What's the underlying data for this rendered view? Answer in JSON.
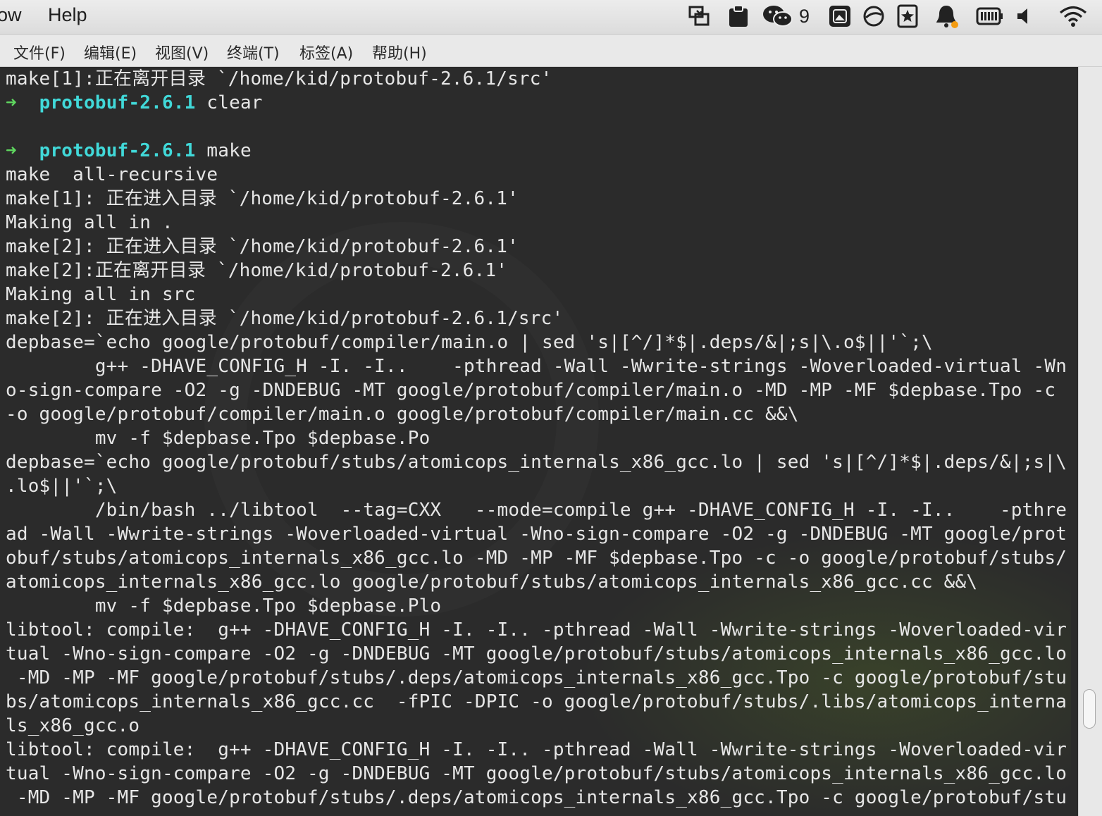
{
  "system_menu": {
    "view": "ow",
    "help": "Help"
  },
  "tray": {
    "icons": [
      "screen-share-icon",
      "clipboard-icon",
      "wechat-icon",
      "photos-icon",
      "circle-slash-icon",
      "bookmark-star-icon",
      "notification-bell-icon",
      "battery-icon",
      "volume-icon",
      "wifi-icon"
    ],
    "wechat_count": "9"
  },
  "terminal_menu": {
    "file": "文件(F)",
    "edit": "编辑(E)",
    "view": "视图(V)",
    "terminal": "终端(T)",
    "tabs": "标签(A)",
    "help": "帮助(H)"
  },
  "terminal": {
    "colors": {
      "background": "#2b2b2b",
      "text": "#e6e6e6",
      "prompt_arrow": "#5fd75f",
      "prompt_dir": "#41d9d9"
    },
    "lines": [
      {
        "text": "make[1]:正在离开目录 `/home/kid/protobuf-2.6.1/src'"
      },
      {
        "arrow": "➜",
        "dir": "protobuf-2.6.1",
        "text": " clear"
      },
      {
        "text": ""
      },
      {
        "arrow": "➜",
        "dir": "protobuf-2.6.1",
        "text": " make"
      },
      {
        "text": "make  all-recursive"
      },
      {
        "text": "make[1]: 正在进入目录 `/home/kid/protobuf-2.6.1'"
      },
      {
        "text": "Making all in ."
      },
      {
        "text": "make[2]: 正在进入目录 `/home/kid/protobuf-2.6.1'"
      },
      {
        "text": "make[2]:正在离开目录 `/home/kid/protobuf-2.6.1'"
      },
      {
        "text": "Making all in src"
      },
      {
        "text": "make[2]: 正在进入目录 `/home/kid/protobuf-2.6.1/src'"
      },
      {
        "text": "depbase=`echo google/protobuf/compiler/main.o | sed 's|[^/]*$|.deps/&|;s|\\.o$||'`;\\"
      },
      {
        "text": "        g++ -DHAVE_CONFIG_H -I. -I..    -pthread -Wall -Wwrite-strings -Woverloaded-virtual -Wn"
      },
      {
        "text": "o-sign-compare -O2 -g -DNDEBUG -MT google/protobuf/compiler/main.o -MD -MP -MF $depbase.Tpo -c"
      },
      {
        "text": "-o google/protobuf/compiler/main.o google/protobuf/compiler/main.cc &&\\"
      },
      {
        "text": "        mv -f $depbase.Tpo $depbase.Po"
      },
      {
        "text": "depbase=`echo google/protobuf/stubs/atomicops_internals_x86_gcc.lo | sed 's|[^/]*$|.deps/&|;s|\\"
      },
      {
        "text": ".lo$||'`;\\"
      },
      {
        "text": "        /bin/bash ../libtool  --tag=CXX   --mode=compile g++ -DHAVE_CONFIG_H -I. -I..    -pthre"
      },
      {
        "text": "ad -Wall -Wwrite-strings -Woverloaded-virtual -Wno-sign-compare -O2 -g -DNDEBUG -MT google/prot"
      },
      {
        "text": "obuf/stubs/atomicops_internals_x86_gcc.lo -MD -MP -MF $depbase.Tpo -c -o google/protobuf/stubs/"
      },
      {
        "text": "atomicops_internals_x86_gcc.lo google/protobuf/stubs/atomicops_internals_x86_gcc.cc &&\\"
      },
      {
        "text": "        mv -f $depbase.Tpo $depbase.Plo"
      },
      {
        "text": "libtool: compile:  g++ -DHAVE_CONFIG_H -I. -I.. -pthread -Wall -Wwrite-strings -Woverloaded-vir"
      },
      {
        "text": "tual -Wno-sign-compare -O2 -g -DNDEBUG -MT google/protobuf/stubs/atomicops_internals_x86_gcc.lo"
      },
      {
        "text": " -MD -MP -MF google/protobuf/stubs/.deps/atomicops_internals_x86_gcc.Tpo -c google/protobuf/stu"
      },
      {
        "text": "bs/atomicops_internals_x86_gcc.cc  -fPIC -DPIC -o google/protobuf/stubs/.libs/atomicops_interna"
      },
      {
        "text": "ls_x86_gcc.o"
      },
      {
        "text": "libtool: compile:  g++ -DHAVE_CONFIG_H -I. -I.. -pthread -Wall -Wwrite-strings -Woverloaded-vir"
      },
      {
        "text": "tual -Wno-sign-compare -O2 -g -DNDEBUG -MT google/protobuf/stubs/atomicops_internals_x86_gcc.lo"
      },
      {
        "text": " -MD -MP -MF google/protobuf/stubs/.deps/atomicops_internals_x86_gcc.Tpo -c google/protobuf/stu"
      }
    ]
  }
}
